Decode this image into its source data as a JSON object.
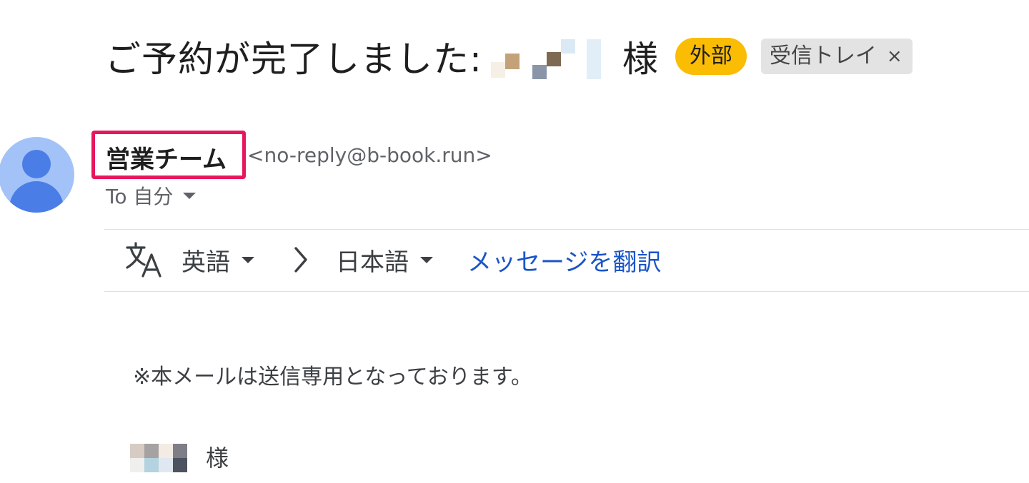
{
  "email": {
    "subject": "ご予約が完了しました:",
    "subject_suffix": "様",
    "labels": {
      "external": "外部",
      "inbox": "受信トレイ",
      "inbox_close": "×"
    },
    "sender": {
      "name": "営業チーム",
      "email": "<no-reply@b-book.run>"
    },
    "recipient": {
      "to": "To 自分"
    },
    "translate": {
      "source_lang": "英語",
      "target_lang": "日本語",
      "translate_link": "メッセージを翻訳"
    },
    "body": {
      "notice": "※本メールは送信専用となっております。",
      "greeting_suffix": "様"
    }
  },
  "colors": {
    "external_label": "#fbbc04",
    "inbox_label": "#e3e3e3",
    "sender_highlight": "#e8175d",
    "link": "#1a55c8",
    "avatar_bg": "#a3c2f8",
    "avatar_fg": "#4a7de6"
  },
  "icons": [
    "translate-icon",
    "chevron-right-icon",
    "caret-down-icon",
    "avatar-person-icon"
  ]
}
